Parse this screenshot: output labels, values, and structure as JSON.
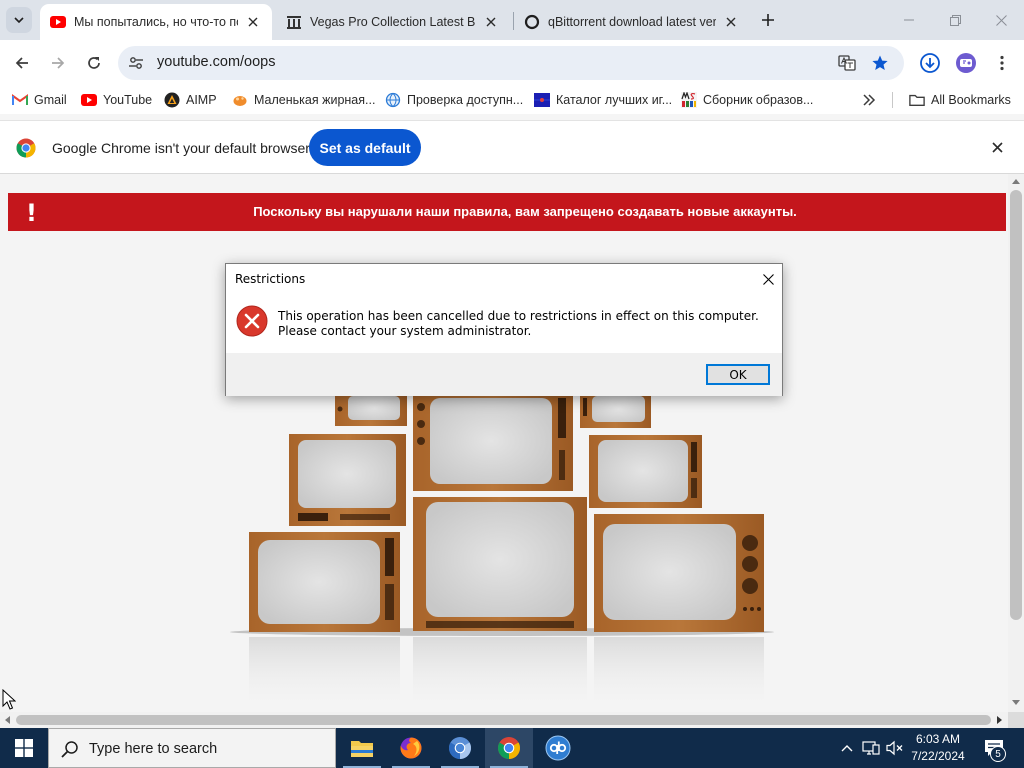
{
  "browser": {
    "tabs": [
      {
        "title": "Мы попытались, но что-то по",
        "favicon": "youtube-icon",
        "active": true
      },
      {
        "title": "Vegas Pro Collection Latest Buil",
        "favicon": "archive-site-icon",
        "active": false
      },
      {
        "title": "qBittorrent download latest ver",
        "favicon": "circle-site-icon",
        "active": false
      }
    ],
    "address": "youtube.com/oops",
    "accent": "#0b57d0"
  },
  "bookmarks": {
    "items": [
      {
        "label": "Gmail",
        "icon": "gmail-icon"
      },
      {
        "label": "YouTube",
        "icon": "youtube-icon"
      },
      {
        "label": "AIMP",
        "icon": "aimp-icon"
      },
      {
        "label": "Маленькая жирная...",
        "icon": "bookmark-favicon-orange"
      },
      {
        "label": "Проверка доступн...",
        "icon": "bookmark-favicon-globe"
      },
      {
        "label": "Каталог лучших иг...",
        "icon": "bookmark-favicon-flag"
      },
      {
        "label": "Сборник образов...",
        "icon": "bookmark-favicon-ms"
      }
    ],
    "all_label": "All Bookmarks"
  },
  "infobar": {
    "text": "Google Chrome isn't your default browser",
    "button": "Set as default"
  },
  "page": {
    "banner_text": "Поскольку вы нарушали наши правила, вам запрещено создавать новые аккаунты.",
    "banner_color": "#c4161c",
    "banner_mark": "!"
  },
  "dialog": {
    "title": "Restrictions",
    "message": "This operation has been cancelled due to restrictions in effect on this computer. Please contact your system administrator.",
    "ok": "OK"
  },
  "taskbar": {
    "search_placeholder": "Type here to search",
    "apps": [
      "file-explorer-icon",
      "firefox-icon",
      "chromium-icon",
      "chrome-icon",
      "qbittorrent-icon"
    ],
    "time": "6:03 AM",
    "date": "7/22/2024",
    "notification_count": "5",
    "bg": "#102b4a"
  }
}
